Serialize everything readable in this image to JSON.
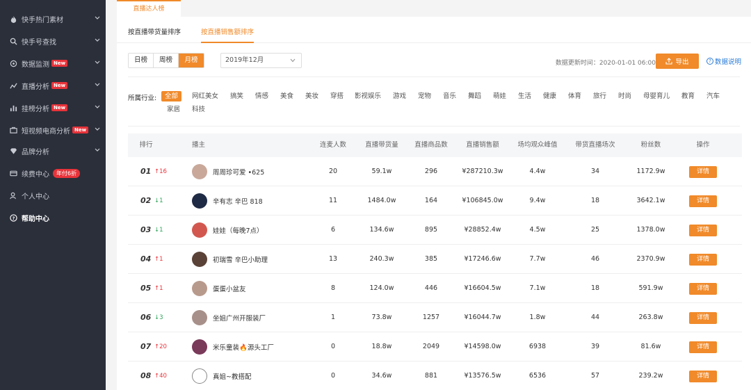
{
  "sidebar": {
    "items": [
      {
        "label": "快手热门素材",
        "icon": "flame-icon"
      },
      {
        "label": "快手号查找",
        "icon": "search-icon"
      },
      {
        "label": "数据监测",
        "icon": "monitor-icon",
        "badge": "New"
      },
      {
        "label": "直播分析",
        "icon": "trend-icon",
        "badge": "New"
      },
      {
        "label": "挂榜分析",
        "icon": "bar-chart-icon",
        "badge": "New"
      },
      {
        "label": "短视频电商分析",
        "icon": "cart-icon",
        "badge": "New"
      },
      {
        "label": "品牌分析",
        "icon": "diamond-icon"
      },
      {
        "label": "续费中心",
        "icon": "card-icon",
        "promo": "年付6折"
      },
      {
        "label": "个人中心",
        "icon": "user-icon"
      },
      {
        "label": "帮助中心",
        "icon": "help-icon"
      }
    ]
  },
  "top_tab": "直播达人榜",
  "sort_tabs": [
    "按直播带货量排序",
    "按直播销售额排序"
  ],
  "period": [
    "日榜",
    "周榜",
    "月榜"
  ],
  "month": "2019年12月",
  "update_time": "数据更新时间：2020-01-01 06:00",
  "export_label": "导出",
  "help_label": "数据说明",
  "industry": {
    "label": "所属行业:",
    "tags": [
      "全部",
      "网红美女",
      "搞笑",
      "情感",
      "美食",
      "美妆",
      "穿搭",
      "影视娱乐",
      "游戏",
      "宠物",
      "音乐",
      "舞蹈",
      "萌娃",
      "生活",
      "健康",
      "体育",
      "旅行",
      "时尚",
      "母婴育儿",
      "教育",
      "汽车",
      "家居",
      "科技"
    ]
  },
  "table": {
    "headers": [
      "排行",
      "播主",
      "连麦人数",
      "直播带货量",
      "直播商品数",
      "直播销售额",
      "场均观众峰值",
      "带货直播场次",
      "粉丝数",
      "操作"
    ],
    "detail_label": "详情",
    "rows": [
      {
        "rank": "01",
        "change": "↑16",
        "dir": "up",
        "name": "周周珍可爱 •625",
        "lianmai": "20",
        "volume": "59.1w",
        "products": "296",
        "sales": "¥287210.3w",
        "peak": "4.4w",
        "sessions": "34",
        "fans": "1172.9w",
        "avatar": "#c9a89a"
      },
      {
        "rank": "02",
        "change": "↓1",
        "dir": "down",
        "name": "辛有志 辛巴 818",
        "lianmai": "11",
        "volume": "1484.0w",
        "products": "164",
        "sales": "¥106845.0w",
        "peak": "9.4w",
        "sessions": "18",
        "fans": "3642.1w",
        "avatar": "#1f2a44"
      },
      {
        "rank": "03",
        "change": "↓1",
        "dir": "down",
        "name": "娃娃（每晚7点）",
        "lianmai": "6",
        "volume": "134.6w",
        "products": "895",
        "sales": "¥28852.4w",
        "peak": "4.5w",
        "sessions": "25",
        "fans": "1378.0w",
        "avatar": "#d2584f"
      },
      {
        "rank": "04",
        "change": "↑1",
        "dir": "up",
        "name": "初瑞雪 辛巴小助理",
        "lianmai": "13",
        "volume": "240.3w",
        "products": "385",
        "sales": "¥17246.6w",
        "peak": "7.7w",
        "sessions": "46",
        "fans": "2370.9w",
        "avatar": "#5a4238"
      },
      {
        "rank": "05",
        "change": "↑1",
        "dir": "up",
        "name": "蛋蛋小盆友",
        "lianmai": "8",
        "volume": "124.0w",
        "products": "446",
        "sales": "¥16604.5w",
        "peak": "7.1w",
        "sessions": "18",
        "fans": "591.9w",
        "avatar": "#b89a8c"
      },
      {
        "rank": "06",
        "change": "↓3",
        "dir": "down",
        "name": "坐姐广州开服装厂",
        "lianmai": "1",
        "volume": "73.8w",
        "products": "1257",
        "sales": "¥16044.7w",
        "peak": "1.8w",
        "sessions": "44",
        "fans": "263.8w",
        "avatar": "#a8908a"
      },
      {
        "rank": "07",
        "change": "↑20",
        "dir": "up",
        "name": "米乐童装🔥源头工厂",
        "lianmai": "0",
        "volume": "18.8w",
        "products": "2049",
        "sales": "¥14598.0w",
        "peak": "6938",
        "sessions": "39",
        "fans": "81.6w",
        "avatar": "#7a3a5a"
      },
      {
        "rank": "08",
        "change": "↑40",
        "dir": "up",
        "name": "真姐~教搭配",
        "lianmai": "0",
        "volume": "34.6w",
        "products": "881",
        "sales": "¥13576.5w",
        "peak": "6536",
        "sessions": "57",
        "fans": "239.2w",
        "avatar": "#ffffff"
      }
    ]
  },
  "colors": {
    "accent": "#f08a2a",
    "sidebar_bg": "#2b2f3a",
    "up": "#e8333a",
    "down": "#2ea35a",
    "link": "#2b7bd6"
  }
}
